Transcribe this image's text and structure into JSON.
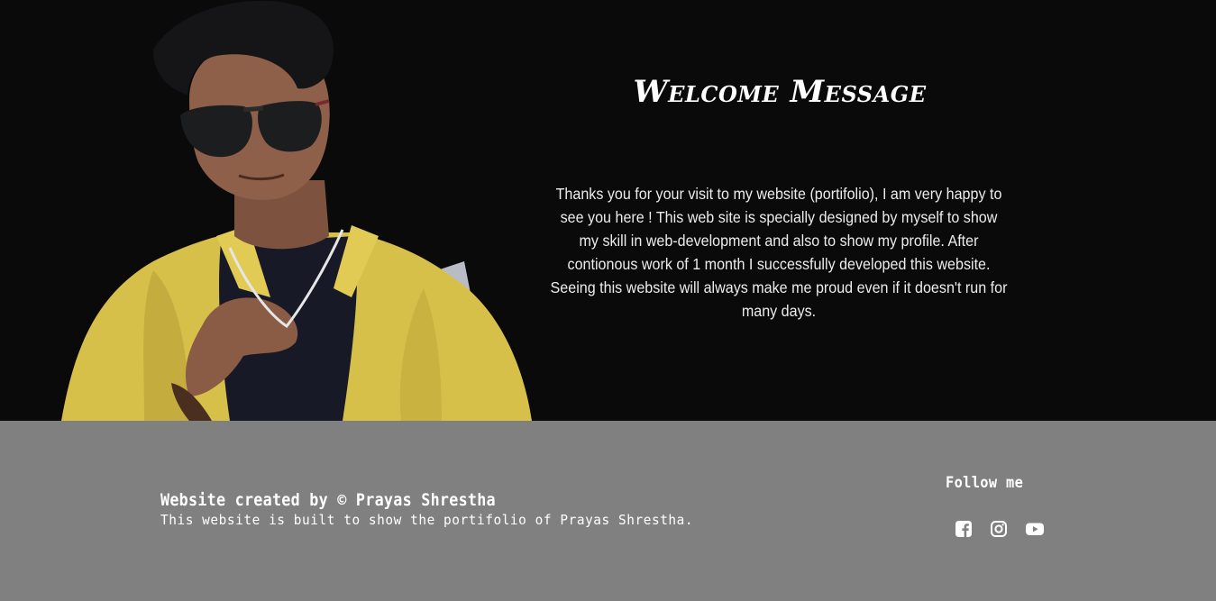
{
  "hero": {
    "title": "Welcome Message",
    "message": "Thanks you for your visit to my website (portifolio), I am very happy to see you here ! This web site is specially designed by myself to show my skill in web-development and also to show my profile. After contionous work of 1 month I successfully developed this website. Seeing this website will always make me proud even if it doesn't run for many days."
  },
  "footer": {
    "credit": "Website created by © Prayas Shrestha",
    "description": "This website is built to show the portifolio of Prayas Shrestha.",
    "follow_title": "Follow me",
    "social_icons": [
      "facebook-icon",
      "instagram-icon",
      "youtube-icon"
    ]
  },
  "colors": {
    "hero_background": "#0b0a0b",
    "footer_background": "#808080",
    "text": "#ffffff"
  }
}
